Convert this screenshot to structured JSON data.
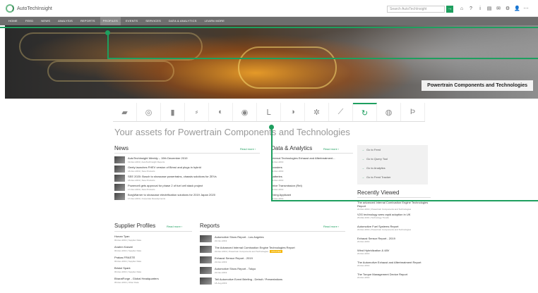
{
  "app": {
    "logo_text": "AutoTechInsight"
  },
  "search": {
    "placeholder": "Search AutoTechInsight",
    "button": "→"
  },
  "toolbar_icons": [
    "home-icon",
    "help-icon",
    "info-icon",
    "document-icon",
    "mail-icon",
    "settings-icon",
    "user-icon",
    "more-icon"
  ],
  "toolbar_glyphs": [
    "⌂",
    "?",
    "i",
    "▤",
    "✉",
    "⚙",
    "👤",
    "⋯"
  ],
  "nav": {
    "items": [
      "HOME",
      "FEED",
      "NEWS",
      "ANALYSIS",
      "REPORTS",
      "PROFILES",
      "EVENTS",
      "SERVICES",
      "DATA & ANALYTICS",
      "LEARN MORE"
    ],
    "active_index": 5
  },
  "hero": {
    "caption": "Powertrain Components and Technologies"
  },
  "tabs": [
    {
      "icon": "engine-icon",
      "glyph": "▰"
    },
    {
      "icon": "gear-icon",
      "glyph": "◎"
    },
    {
      "icon": "battery-icon",
      "glyph": "▮"
    },
    {
      "icon": "transmission-icon",
      "glyph": "⸗"
    },
    {
      "icon": "turbo-icon",
      "glyph": "◐"
    },
    {
      "icon": "wheel-icon",
      "glyph": "◉"
    },
    {
      "icon": "exhaust-icon",
      "glyph": "ᒪ"
    },
    {
      "icon": "fan-icon",
      "glyph": "◑"
    },
    {
      "icon": "network-icon",
      "glyph": "✲"
    },
    {
      "icon": "wrench-icon",
      "glyph": "⟋"
    },
    {
      "icon": "cycle-icon",
      "glyph": "↻"
    },
    {
      "icon": "radial-icon",
      "glyph": "◍"
    },
    {
      "icon": "plug-icon",
      "glyph": "Ϸ"
    }
  ],
  "active_tab": 10,
  "page_title": "Your assets for Powertrain Components and Technologies",
  "news": {
    "heading": "News",
    "read_more": "Read more ›",
    "items": [
      {
        "title": "AutoTechInsight Weekly – 19th December 2019",
        "meta": "19-Dec-2019 | AutoTechInsight Reports"
      },
      {
        "title": "Geely launches FHEV version of Binrui and plugs in hybrid",
        "meta": "18-Dec-2019 | New Products"
      },
      {
        "title": "SEE 2020: Bosch to showcase powertrains, chassis solutions for ZEVs",
        "meta": "18-Dec-2019 | New Products"
      },
      {
        "title": "Powercell gets approval for phase 2 of fuel cell stack project",
        "meta": "17-Dec-2019 | New Products"
      },
      {
        "title": "BorgWarner to showcase electrification solutions for 2019 Japan 2020",
        "meta": "17-Dec-2019 | Corporate Developments"
      }
    ]
  },
  "data_analytics": {
    "heading": "Data & Analytics",
    "read_more": "Read more ›",
    "items": [
      {
        "title": "Internal Technologies Exhaust and Aftertreatment...",
        "meta": "19-Dec-2019"
      },
      {
        "title": "Boosters",
        "meta": "19-Dec-2019"
      },
      {
        "title": "Batteries",
        "meta": "19-Dec-2019"
      },
      {
        "title": "Drive Transmission (Rel)",
        "meta": "19-Dec-2019"
      },
      {
        "title": "Fixing Applicant",
        "meta": "19-Dec-2019"
      }
    ]
  },
  "quick_links": [
    "Go to Feed",
    "Go to Query Tool",
    "Go to Analytics",
    "Go to Feed Tracker"
  ],
  "recently_viewed": {
    "heading": "Recently Viewed",
    "items": [
      {
        "title": "The advanced Internal Combustion Engine Technologies Report",
        "meta": "22-Dec-2019 | Powertrain Components and Technologies"
      },
      {
        "title": "V2G technology sees rapid adoption in UK",
        "meta": "29-Mar-2019 | Technology Trends"
      },
      {
        "title": "Automotive Fuel Systems Report",
        "meta": "22-Dec-2019 | Powertrain Components and Technologies"
      },
      {
        "title": "Exhaust Sensor Report - 2019",
        "meta": "22-Dec-2019"
      },
      {
        "title": "Wind Hybridization & 48V",
        "meta": "22-Dec-2019"
      },
      {
        "title": "The Automotive Exhaust and Aftertreatment Report",
        "meta": "22-Dec-2019"
      },
      {
        "title": "The Torque Management Device Report",
        "meta": "22-Dec-2019"
      }
    ]
  },
  "supplier_profiles": {
    "heading": "Supplier Profiles",
    "read_more": "Read more ›",
    "items": [
      {
        "title": "Hunan Tyan",
        "meta": "06-Dec-2019 | Supplier Data"
      },
      {
        "title": "Anahm Kanzei",
        "meta": "06-Dec-2019 | Supplier Data"
      },
      {
        "title": "Prakas FRASTE",
        "meta": "06-Dec-2019 | Supplier Data"
      },
      {
        "title": "Bristol Spark",
        "meta": "06-Dec-2019 | Supplier Data"
      },
      {
        "title": "BharatForge - Global Headquarters",
        "meta": "05-Dec-2019 | Other Data"
      }
    ]
  },
  "reports": {
    "heading": "Reports",
    "read_more": "Read more ›",
    "badge": "UPDATED",
    "items": [
      {
        "title": "Automotive Show Report - Los Angeles",
        "meta": "22-Nov-2019"
      },
      {
        "title": "The Advanced Internal Combustion Engine Technologies Report",
        "meta": "22-Dec-2019 | Powertrain Components and Technologies",
        "badge": true
      },
      {
        "title": "Exhaust Sensor Report - 2019",
        "meta": "22-Dec-2019"
      },
      {
        "title": "Automotive Show Report - Tokyo",
        "meta": "22-Nov-2019"
      },
      {
        "title": "Tell Automotive Event Briefing - Detroit / Presentations",
        "meta": "18-Aug-2019"
      }
    ]
  },
  "colors": {
    "accent": "#1e9f5f",
    "nav": "#6e6e6e",
    "badge": "#f4b400"
  }
}
